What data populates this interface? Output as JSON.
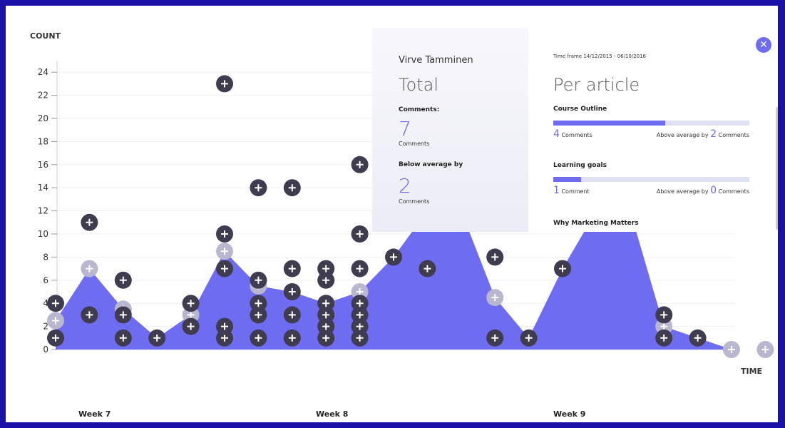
{
  "chart_data": {
    "type": "area",
    "ylabel": "COUNT",
    "xlabel": "TIME",
    "ylim": [
      0,
      25
    ],
    "yticks": [
      0,
      2,
      4,
      6,
      8,
      10,
      12,
      14,
      16,
      18,
      20,
      22,
      24
    ],
    "week_labels": [
      "Week 7",
      "Week 8",
      "Week 9"
    ],
    "area_x": [
      0,
      1,
      2,
      3,
      4,
      5,
      6,
      7,
      8,
      9,
      10,
      11,
      12,
      13,
      14,
      15,
      16,
      17,
      18,
      19,
      20
    ],
    "area_y": [
      2.5,
      7,
      3.5,
      1,
      3,
      8.5,
      5.5,
      5,
      4,
      5,
      8,
      12,
      12,
      4.5,
      1,
      7,
      12,
      12,
      2,
      1,
      0
    ],
    "points": [
      {
        "x": 0,
        "y": 1
      },
      {
        "x": 0,
        "y": 4
      },
      {
        "x": 1,
        "y": 3
      },
      {
        "x": 1,
        "y": 11
      },
      {
        "x": 2,
        "y": 1
      },
      {
        "x": 2,
        "y": 3
      },
      {
        "x": 2,
        "y": 6
      },
      {
        "x": 3,
        "y": 1
      },
      {
        "x": 4,
        "y": 2
      },
      {
        "x": 4,
        "y": 4
      },
      {
        "x": 5,
        "y": 1
      },
      {
        "x": 5,
        "y": 2
      },
      {
        "x": 5,
        "y": 7
      },
      {
        "x": 5,
        "y": 10
      },
      {
        "x": 5,
        "y": 23
      },
      {
        "x": 6,
        "y": 1
      },
      {
        "x": 6,
        "y": 3
      },
      {
        "x": 6,
        "y": 4
      },
      {
        "x": 6,
        "y": 6
      },
      {
        "x": 6,
        "y": 14
      },
      {
        "x": 7,
        "y": 1
      },
      {
        "x": 7,
        "y": 3
      },
      {
        "x": 7,
        "y": 5
      },
      {
        "x": 7,
        "y": 7
      },
      {
        "x": 7,
        "y": 14
      },
      {
        "x": 8,
        "y": 1
      },
      {
        "x": 8,
        "y": 2
      },
      {
        "x": 8,
        "y": 3
      },
      {
        "x": 8,
        "y": 4
      },
      {
        "x": 8,
        "y": 6
      },
      {
        "x": 8,
        "y": 7
      },
      {
        "x": 9,
        "y": 1
      },
      {
        "x": 9,
        "y": 2
      },
      {
        "x": 9,
        "y": 3
      },
      {
        "x": 9,
        "y": 4
      },
      {
        "x": 9,
        "y": 7
      },
      {
        "x": 9,
        "y": 10
      },
      {
        "x": 9,
        "y": 16
      },
      {
        "x": 10,
        "y": 8
      },
      {
        "x": 11,
        "y": 7
      },
      {
        "x": 13,
        "y": 1
      },
      {
        "x": 13,
        "y": 8
      },
      {
        "x": 14,
        "y": 1
      },
      {
        "x": 15,
        "y": 7
      },
      {
        "x": 18,
        "y": 1
      },
      {
        "x": 18,
        "y": 3
      },
      {
        "x": 19,
        "y": 1
      }
    ],
    "faded_points": [
      {
        "x": 0,
        "y": 2.5
      },
      {
        "x": 1,
        "y": 7
      },
      {
        "x": 2,
        "y": 3.5
      },
      {
        "x": 4,
        "y": 3
      },
      {
        "x": 5,
        "y": 8.5
      },
      {
        "x": 6,
        "y": 5.5
      },
      {
        "x": 9,
        "y": 5
      },
      {
        "x": 13,
        "y": 4.5
      },
      {
        "x": 18,
        "y": 2
      },
      {
        "x": 20,
        "y": 0
      },
      {
        "x": 21,
        "y": 0
      }
    ]
  },
  "colors": {
    "area": "#6e6cf0",
    "point": "#3e3c4e",
    "faded_point": "#b9b6cf",
    "frame": "#1a12a8"
  },
  "panel": {
    "person_name": "Virve Tamminen",
    "total": {
      "heading": "Total",
      "comments_label": "Comments:",
      "comments_value": "7",
      "comments_unit": "Comments",
      "below_label": "Below average by",
      "below_value": "2",
      "below_unit": "Comments"
    },
    "per_article": {
      "timeframe": "Time frame 14/12/2015 - 06/10/2016",
      "heading": "Per article",
      "articles": [
        {
          "title": "Course Outline",
          "count": "4",
          "count_unit": "Comments",
          "fill": 0.57,
          "avg_text": "Above average by",
          "avg_value": "2",
          "avg_unit": "Comments"
        },
        {
          "title": "Learning goals",
          "count": "1",
          "count_unit": "Comment",
          "fill": 0.14,
          "avg_text": "Above average by",
          "avg_value": "0",
          "avg_unit": "Comments"
        }
      ],
      "next_title": "Why Marketing Matters"
    },
    "close_icon": "close-icon"
  }
}
